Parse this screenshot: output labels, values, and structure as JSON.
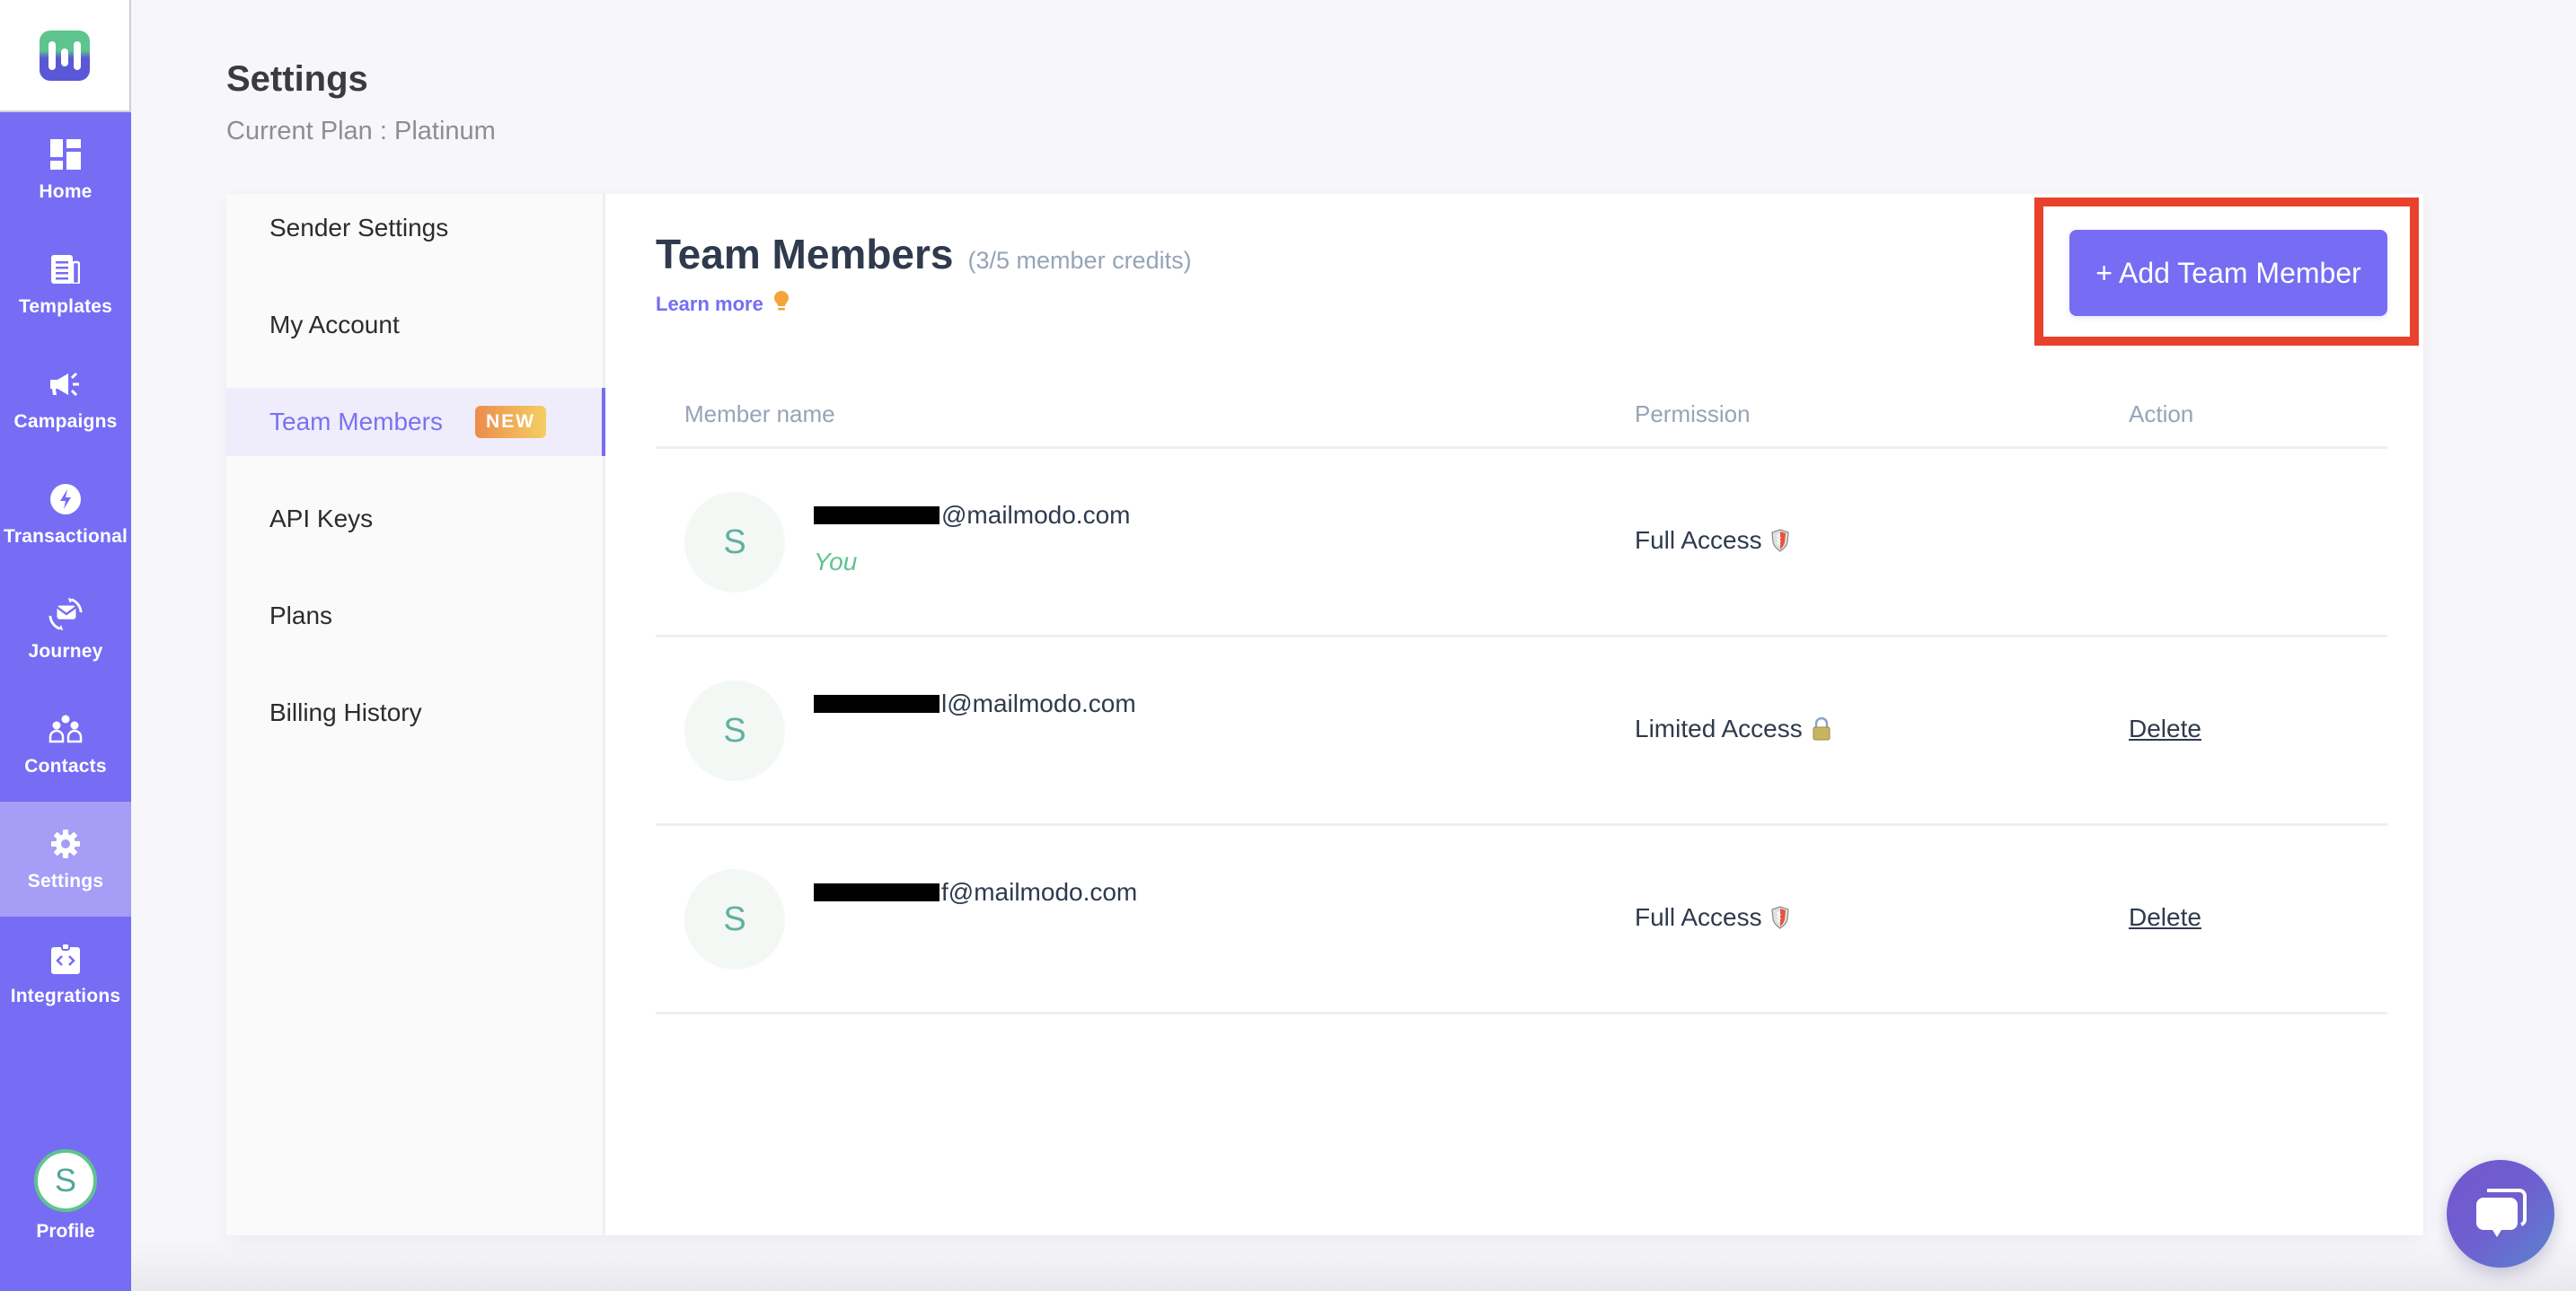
{
  "app": {
    "brand_colors": {
      "primary": "#766df4",
      "accent_green": "#5ec48e",
      "highlight_red": "#e8412c"
    },
    "logo_icon": "mailmodo-logo-icon"
  },
  "sidebar": {
    "items": [
      {
        "label": "Home",
        "icon": "dashboard-grid-icon",
        "active": false
      },
      {
        "label": "Templates",
        "icon": "document-icon",
        "active": false
      },
      {
        "label": "Campaigns",
        "icon": "megaphone-icon",
        "active": false
      },
      {
        "label": "Transactional",
        "icon": "lightning-icon",
        "active": false
      },
      {
        "label": "Journey",
        "icon": "mail-cycle-icon",
        "active": false
      },
      {
        "label": "Contacts",
        "icon": "people-icon",
        "active": false
      },
      {
        "label": "Settings",
        "icon": "gear-icon",
        "active": true
      },
      {
        "label": "Integrations",
        "icon": "code-clipboard-icon",
        "active": false
      }
    ],
    "profile": {
      "initial": "S",
      "label": "Profile"
    }
  },
  "header": {
    "title": "Settings",
    "subtitle": "Current Plan : Platinum"
  },
  "settings_nav": {
    "items": [
      {
        "label": "Sender Settings",
        "active": false
      },
      {
        "label": "My Account",
        "active": false
      },
      {
        "label": "Team Members",
        "active": true,
        "badge": "NEW"
      },
      {
        "label": "API Keys",
        "active": false
      },
      {
        "label": "Plans",
        "active": false
      },
      {
        "label": "Billing History",
        "active": false
      }
    ]
  },
  "team": {
    "title": "Team Members",
    "credits": "(3/5 member credits)",
    "learn_more": "Learn more",
    "add_button": "+ Add Team Member",
    "columns": {
      "name": "Member name",
      "permission": "Permission",
      "action": "Action"
    },
    "members": [
      {
        "initial": "S",
        "email_suffix": "@mailmodo.com",
        "email_visible_tail": "@mailmodo.com",
        "you_label": "You",
        "permission": "Full Access",
        "permission_icon": "shield-icon",
        "action": ""
      },
      {
        "initial": "S",
        "email_suffix": "l@mailmodo.com",
        "email_visible_tail": "l@mailmodo.com",
        "you_label": "",
        "permission": "Limited Access",
        "permission_icon": "lock-icon",
        "action": "Delete"
      },
      {
        "initial": "S",
        "email_suffix": "f@mailmodo.com",
        "email_visible_tail": "f@mailmodo.com",
        "you_label": "",
        "permission": "Full Access",
        "permission_icon": "shield-icon",
        "action": "Delete"
      }
    ]
  },
  "chat": {
    "icon": "chat-bubbles-icon"
  }
}
